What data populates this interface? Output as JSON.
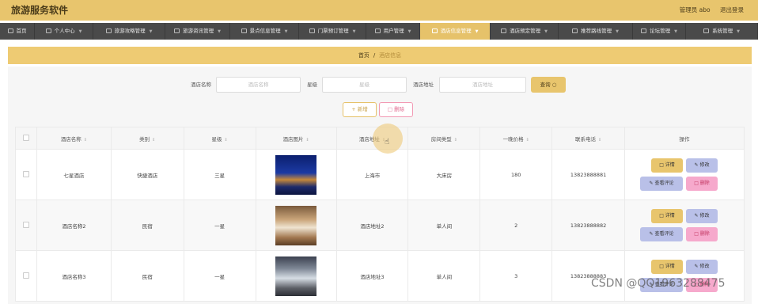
{
  "header": {
    "app_title": "旅游服务软件",
    "user_label": "管理员 abo",
    "logout": "退出登录"
  },
  "nav": [
    {
      "label": "首页",
      "icon": "home-icon"
    },
    {
      "label": "个人中心",
      "icon": "user-icon"
    },
    {
      "label": "旅游攻略管理",
      "icon": "circle-icon"
    },
    {
      "label": "旅游资讯管理",
      "icon": "doc-icon"
    },
    {
      "label": "景点信息管理",
      "icon": "grid-icon"
    },
    {
      "label": "门票预订管理",
      "icon": "pin-icon"
    },
    {
      "label": "用户管理",
      "icon": "list-icon"
    },
    {
      "label": "酒店信息管理",
      "icon": "hotel-icon",
      "active": true
    },
    {
      "label": "酒店预定管理",
      "icon": "frame-icon"
    },
    {
      "label": "推荐路线管理",
      "icon": "route-icon"
    },
    {
      "label": "论坛管理",
      "icon": "forum-icon"
    },
    {
      "label": "系统管理",
      "icon": "settings-icon"
    }
  ],
  "breadcrumb": {
    "home": "首页",
    "separator": "/",
    "current": "酒店信息"
  },
  "search": {
    "name_label": "酒店名称",
    "name_placeholder": "酒店名称",
    "star_label": "星级",
    "star_placeholder": "星级",
    "address_label": "酒店地址",
    "address_placeholder": "酒店地址",
    "query_button": "查询 ○"
  },
  "actions": {
    "add": "+ 新增",
    "delete": "□ 删除"
  },
  "table": {
    "columns": [
      "酒店名称",
      "类别",
      "星级",
      "酒店图片",
      "酒店地址",
      "房间类型",
      "一晚价格",
      "联系电话",
      "操作"
    ],
    "rows": [
      {
        "name": "七星酒店",
        "category": "快捷酒店",
        "star": "三星",
        "address": "上海市",
        "room_type": "大床房",
        "price": "180",
        "phone": "13823888881"
      },
      {
        "name": "酒店名称2",
        "category": "民宿",
        "star": "一星",
        "address": "酒店地址2",
        "room_type": "单人间",
        "price": "2",
        "phone": "13823888882"
      },
      {
        "name": "酒店名称3",
        "category": "民宿",
        "star": "一星",
        "address": "酒店地址3",
        "room_type": "单人间",
        "price": "3",
        "phone": "13823888883"
      }
    ],
    "row_ops": {
      "detail": "□ 详情",
      "edit": "✎ 修改",
      "review": "✎ 查看评论",
      "delete": "□ 删除"
    }
  },
  "watermark": "CSDN @QQ1963288475"
}
